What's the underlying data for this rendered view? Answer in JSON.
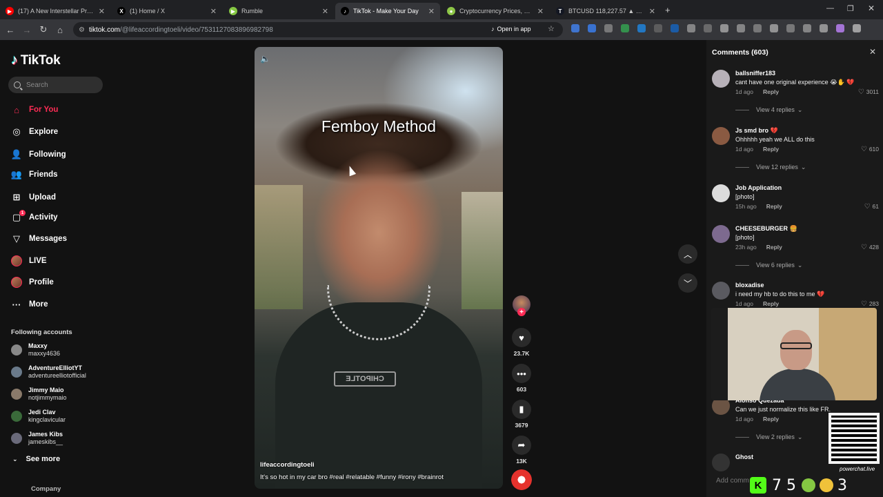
{
  "browser": {
    "tabs": [
      {
        "label": "(17) A New Interstellar Propulsi",
        "color": "#ff0000",
        "glyph": "▶",
        "active": false
      },
      {
        "label": "(1) Home / X",
        "color": "#000000",
        "glyph": "X",
        "active": false
      },
      {
        "label": "Rumble",
        "color": "#85c742",
        "glyph": "▶",
        "active": false
      },
      {
        "label": "TikTok - Make Your Day",
        "color": "#000000",
        "glyph": "♪",
        "active": true
      },
      {
        "label": "Cryptocurrency Prices, Charts, a",
        "color": "#8dc647",
        "glyph": "●",
        "active": false
      },
      {
        "label": "BTCUSD 118,227.57 ▲ +0.21%",
        "color": "#131722",
        "glyph": "T",
        "active": false
      }
    ],
    "url_host": "tiktok.com",
    "url_path": "/@lifeaccordingtoeli/video/7531127083896982798",
    "open_in_app": "Open in app"
  },
  "sidebar": {
    "logo_text": "TikTok",
    "search_placeholder": "Search",
    "nav": [
      {
        "label": "For You",
        "icon": "home-icon",
        "glyph": "⌂",
        "active": true
      },
      {
        "label": "Explore",
        "icon": "compass-icon",
        "glyph": "◎",
        "active": false
      },
      {
        "label": "Following",
        "icon": "following-icon",
        "glyph": "👤",
        "active": false
      },
      {
        "label": "Friends",
        "icon": "friends-icon",
        "glyph": "👥",
        "active": false
      },
      {
        "label": "Upload",
        "icon": "upload-icon",
        "glyph": "⊞",
        "active": false
      },
      {
        "label": "Activity",
        "icon": "activity-icon",
        "glyph": "▢",
        "active": false,
        "badge": "1"
      },
      {
        "label": "Messages",
        "icon": "messages-icon",
        "glyph": "▽",
        "active": false
      },
      {
        "label": "LIVE",
        "icon": "live-avatar",
        "glyph": "",
        "active": false
      },
      {
        "label": "Profile",
        "icon": "profile-avatar",
        "glyph": "",
        "active": false
      },
      {
        "label": "More",
        "icon": "more-icon",
        "glyph": "···",
        "active": false
      }
    ],
    "following_title": "Following accounts",
    "accounts": [
      {
        "name": "Maxxy",
        "handle": "maxxy4636"
      },
      {
        "name": "AdventureElliotYT",
        "handle": "adventureelliotofficial"
      },
      {
        "name": "Jimmy Maio",
        "handle": "notjimmymaio"
      },
      {
        "name": "Jedi Clav",
        "handle": "kingclavicular"
      },
      {
        "name": "James Kibs",
        "handle": "jameskibs__"
      }
    ],
    "see_more": "See more",
    "company": "Company"
  },
  "video": {
    "overlay_title": "Femboy Method",
    "author": "lifeaccordingtoeli",
    "caption": "It's so hot in my car bro #real #relatable #funny #irony #brainrot",
    "shirt_text": "CHIPOTLE"
  },
  "actions": {
    "likes": "23.7K",
    "comments": "603",
    "saves": "3679",
    "shares": "13K"
  },
  "comments": {
    "title": "Comments (603)",
    "items": [
      {
        "user": "ballsniffer183",
        "text": "cant have one original experience 😭✋ 💔",
        "time": "1d ago",
        "reply": "Reply",
        "likes": "3011",
        "view": "View 4 replies",
        "avatar": "#b7b1b8"
      },
      {
        "user": "Js smd bro 💔",
        "text": "Ohhhhh yeah we ALL do this",
        "time": "1d ago",
        "reply": "Reply",
        "likes": "610",
        "view": "View 12 replies",
        "avatar": "#8a5a42"
      },
      {
        "user": "Job Application",
        "text": "[photo]",
        "time": "15h ago",
        "reply": "Reply",
        "likes": "61",
        "view": "",
        "avatar": "#dcdcdc"
      },
      {
        "user": "CHEESEBURGER 🍔",
        "text": "[photo]",
        "time": "23h ago",
        "reply": "Reply",
        "likes": "428",
        "view": "View 6 replies",
        "avatar": "#7d6a8f"
      },
      {
        "user": "bloxadise",
        "text": "i need my hb to do this to me 💔",
        "time": "1d ago",
        "reply": "Reply",
        "likes": "283",
        "view": "",
        "avatar": "#5a5a60"
      },
      {
        "user": "Alonso Quezada",
        "text": "Can we just normalize this like FR.",
        "time": "1d ago",
        "reply": "Reply",
        "likes": "",
        "view": "View 2 replies",
        "avatar": "#6b5444"
      },
      {
        "user": "Ghost",
        "text": "",
        "time": "",
        "reply": "",
        "likes": "",
        "view": "",
        "avatar": "#333"
      }
    ],
    "add_placeholder": "Add comm"
  },
  "overlay": {
    "qr_label": "powerchat.live",
    "kick_score": "7 5",
    "tail_num": "3"
  }
}
